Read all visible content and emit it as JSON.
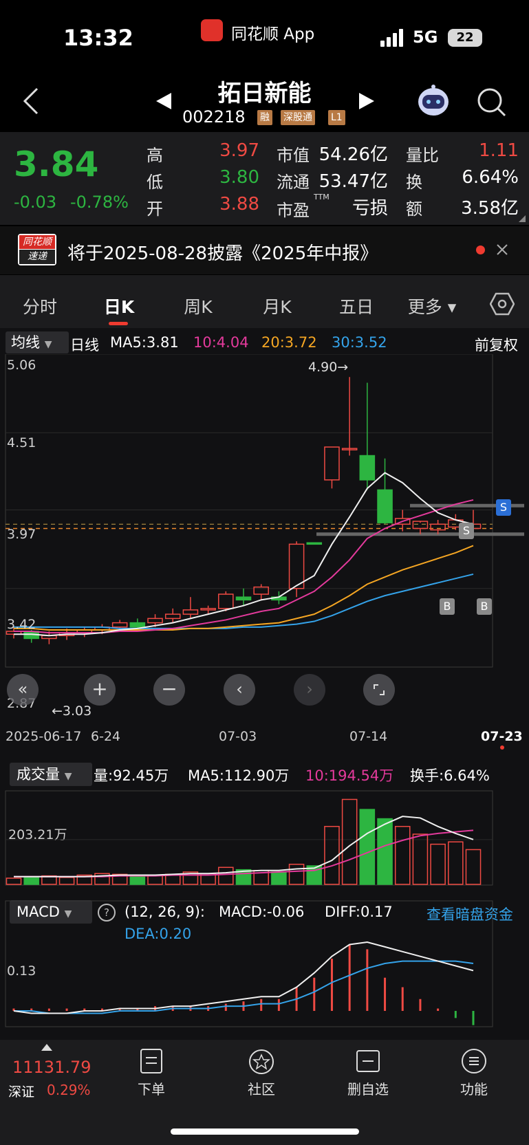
{
  "status": {
    "time": "13:32",
    "app": "同花顺 App",
    "network": "5G",
    "battery": "22"
  },
  "header": {
    "name": "拓日新能",
    "code": "002218",
    "tags": [
      "融",
      "深股通",
      "L1"
    ]
  },
  "quote": {
    "price": "3.84",
    "change": "-0.03",
    "change_pct": "-0.78%",
    "high_label": "高",
    "high": "3.97",
    "low_label": "低",
    "low": "3.80",
    "open_label": "开",
    "open": "3.88",
    "mcap_label": "市值",
    "mcap": "54.26亿",
    "float_label": "流通",
    "float": "53.47亿",
    "pe_label": "市盈",
    "pe_sup": "TTM",
    "pe": "亏损",
    "vr_label": "量比",
    "vr": "1.11",
    "turn_label": "换",
    "turn": "6.64%",
    "amt_label": "额",
    "amt": "3.58亿"
  },
  "notice": {
    "logo_top": "同花顺",
    "logo_bottom": "速递",
    "text": "将于2025-08-28披露《2025年中报》"
  },
  "tabs": [
    "分时",
    "日K",
    "周K",
    "月K",
    "五日",
    "更多"
  ],
  "kline": {
    "indicator": "均线",
    "period": "日线",
    "ma5": "MA5:3.81",
    "ma10": "10:4.04",
    "ma20": "20:3.72",
    "ma30": "30:3.52",
    "adjust": "前复权",
    "y_labels": [
      "5.06",
      "4.51",
      "3.97",
      "3.42",
      "2.87"
    ],
    "high_mark": "4.90→",
    "low_mark": "←3.03",
    "x_labels": [
      "2025-06-17",
      "6-24",
      "07-03",
      "07-14",
      "07-23"
    ],
    "signals": [
      "S",
      "S",
      "B",
      "B"
    ]
  },
  "volume": {
    "indicator": "成交量",
    "vol": "量:92.45万",
    "ma5": "MA5:112.90万",
    "ma10": "10:194.54万",
    "turn": "换手:6.64%",
    "y_label": "203.21万"
  },
  "macd": {
    "indicator": "MACD",
    "params": "(12, 26, 9):",
    "macd": "MACD:-0.06",
    "diff": "DIFF:0.17",
    "dea": "DEA:0.20",
    "link": "查看暗盘资金",
    "y_label": "0.13"
  },
  "chart_data": {
    "type": "candlestick",
    "x": [
      "2025-06-17",
      "06-18",
      "06-19",
      "06-20",
      "06-23",
      "06-24",
      "06-25",
      "06-26",
      "06-27",
      "06-30",
      "07-01",
      "07-02",
      "07-03",
      "07-04",
      "07-07",
      "07-08",
      "07-09",
      "07-10",
      "07-11",
      "07-14",
      "07-15",
      "07-16",
      "07-17",
      "07-18",
      "07-21",
      "07-22",
      "07-23"
    ],
    "open": [
      3.1,
      3.12,
      3.07,
      3.09,
      3.11,
      3.13,
      3.15,
      3.18,
      3.18,
      3.21,
      3.24,
      3.27,
      3.28,
      3.36,
      3.38,
      3.36,
      3.42,
      3.74,
      4.18,
      4.4,
      4.35,
      4.11,
      3.87,
      3.84,
      3.83,
      3.85,
      3.84
    ],
    "close": [
      3.12,
      3.07,
      3.09,
      3.11,
      3.13,
      3.15,
      3.18,
      3.15,
      3.21,
      3.24,
      3.27,
      3.28,
      3.38,
      3.34,
      3.43,
      3.34,
      3.73,
      3.73,
      4.41,
      4.4,
      4.18,
      3.88,
      3.91,
      3.89,
      3.87,
      3.9,
      3.87
    ],
    "high": [
      3.15,
      3.13,
      3.12,
      3.14,
      3.15,
      3.17,
      3.2,
      3.21,
      3.24,
      3.28,
      3.36,
      3.3,
      3.4,
      3.42,
      3.45,
      3.4,
      3.75,
      3.74,
      4.41,
      4.9,
      4.86,
      4.33,
      3.97,
      3.88,
      3.9,
      3.94,
      3.97
    ],
    "low": [
      3.07,
      3.04,
      3.03,
      3.06,
      3.08,
      3.1,
      3.13,
      3.13,
      3.15,
      3.18,
      3.21,
      3.24,
      3.26,
      3.3,
      3.34,
      3.31,
      3.36,
      3.73,
      4.12,
      4.35,
      4.11,
      3.87,
      3.82,
      3.8,
      3.8,
      3.83,
      3.8
    ],
    "ma5": [
      3.1,
      3.1,
      3.09,
      3.1,
      3.1,
      3.11,
      3.13,
      3.14,
      3.16,
      3.18,
      3.21,
      3.24,
      3.27,
      3.3,
      3.34,
      3.36,
      3.44,
      3.51,
      3.73,
      3.92,
      4.12,
      4.23,
      4.16,
      4.05,
      3.95,
      3.9,
      3.87
    ],
    "ma10": [
      3.12,
      3.12,
      3.11,
      3.11,
      3.11,
      3.11,
      3.12,
      3.12,
      3.13,
      3.14,
      3.16,
      3.18,
      3.2,
      3.23,
      3.26,
      3.28,
      3.34,
      3.4,
      3.5,
      3.62,
      3.77,
      3.84,
      3.89,
      3.93,
      3.97,
      4.01,
      4.04
    ],
    "ma20": [
      3.14,
      3.14,
      3.13,
      3.13,
      3.13,
      3.13,
      3.13,
      3.13,
      3.13,
      3.13,
      3.14,
      3.14,
      3.15,
      3.16,
      3.17,
      3.18,
      3.21,
      3.24,
      3.3,
      3.37,
      3.45,
      3.5,
      3.55,
      3.59,
      3.63,
      3.67,
      3.72
    ],
    "ma30": [
      3.15,
      3.15,
      3.15,
      3.15,
      3.15,
      3.15,
      3.14,
      3.14,
      3.14,
      3.14,
      3.14,
      3.14,
      3.14,
      3.15,
      3.15,
      3.16,
      3.17,
      3.19,
      3.23,
      3.28,
      3.33,
      3.37,
      3.4,
      3.43,
      3.46,
      3.49,
      3.52
    ],
    "volume": [
      8,
      10,
      11,
      9,
      12,
      14,
      13,
      11,
      12,
      13,
      16,
      14,
      22,
      19,
      18,
      16,
      26,
      24,
      75,
      110,
      97,
      85,
      75,
      65,
      52,
      55,
      45
    ],
    "vol_ma5": [
      10,
      10,
      10,
      10,
      10,
      11,
      12,
      12,
      12,
      13,
      14,
      14,
      15,
      17,
      18,
      18,
      20,
      21,
      31,
      50,
      66,
      78,
      88,
      86,
      75,
      66,
      58
    ],
    "vol_ma10": [
      10,
      10,
      10,
      10,
      10,
      10,
      11,
      11,
      11,
      12,
      12,
      12,
      13,
      14,
      15,
      16,
      17,
      18,
      24,
      32,
      41,
      50,
      57,
      63,
      66,
      68,
      70
    ],
    "macd_hist": [
      0.01,
      0.01,
      0.01,
      0.01,
      0.01,
      0.01,
      0.01,
      0.01,
      0.02,
      0.02,
      0.02,
      0.02,
      0.03,
      0.04,
      0.05,
      0.05,
      0.1,
      0.14,
      0.22,
      0.28,
      0.26,
      0.14,
      0.1,
      0.05,
      0.01,
      -0.03,
      -0.06
    ],
    "diff": [
      0.0,
      -0.01,
      -0.01,
      -0.01,
      0.0,
      0.0,
      0.01,
      0.01,
      0.01,
      0.02,
      0.02,
      0.03,
      0.04,
      0.05,
      0.06,
      0.06,
      0.1,
      0.16,
      0.23,
      0.28,
      0.29,
      0.27,
      0.25,
      0.23,
      0.21,
      0.19,
      0.17
    ],
    "dea": [
      0.0,
      0.0,
      -0.01,
      -0.01,
      -0.01,
      -0.01,
      0.0,
      0.0,
      0.0,
      0.01,
      0.01,
      0.01,
      0.02,
      0.02,
      0.03,
      0.03,
      0.05,
      0.08,
      0.12,
      0.15,
      0.18,
      0.2,
      0.21,
      0.21,
      0.21,
      0.21,
      0.2
    ],
    "ylim": [
      2.87,
      5.06
    ]
  },
  "index": {
    "value": "11131.79",
    "name": "深证",
    "pct": "0.29%"
  },
  "bottom_nav": [
    "下单",
    "社区",
    "删自选",
    "功能"
  ]
}
